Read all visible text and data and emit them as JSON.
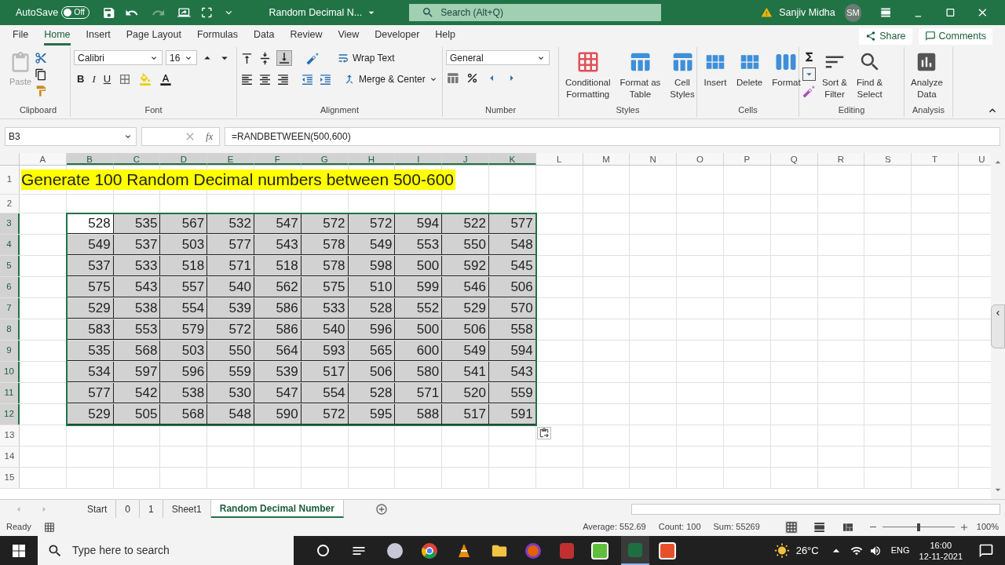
{
  "title_bar": {
    "autosave_label": "AutoSave",
    "autosave_state": "Off",
    "autosave_on": false,
    "file_name": "Random Decimal N...",
    "search_placeholder": "Search (Alt+Q)",
    "user_name": "Sanjiv Midha",
    "user_initials": "SM"
  },
  "ribbon_tabs": [
    {
      "label": "File",
      "selected": false
    },
    {
      "label": "Home",
      "selected": true
    },
    {
      "label": "Insert",
      "selected": false
    },
    {
      "label": "Page Layout",
      "selected": false
    },
    {
      "label": "Formulas",
      "selected": false
    },
    {
      "label": "Data",
      "selected": false
    },
    {
      "label": "Review",
      "selected": false
    },
    {
      "label": "View",
      "selected": false
    },
    {
      "label": "Developer",
      "selected": false
    },
    {
      "label": "Help",
      "selected": false
    }
  ],
  "share": "Share",
  "comments": "Comments",
  "ribbon": {
    "clipboard": {
      "paste": "Paste",
      "label": "Clipboard"
    },
    "font": {
      "font_name": "Calibri",
      "font_size": "16",
      "style_buttons": [
        "B",
        "I",
        "U"
      ],
      "label": "Font"
    },
    "alignment": {
      "wrap_text": "Wrap Text",
      "merge": "Merge & Center",
      "label": "Alignment"
    },
    "number": {
      "format": "General",
      "label": "Number"
    },
    "styles": {
      "buttons": [
        [
          "Conditional",
          "Formatting"
        ],
        [
          "Format as",
          "Table"
        ],
        [
          "Cell",
          "Styles"
        ]
      ],
      "label": "Styles"
    },
    "cells": {
      "buttons": [
        "Insert",
        "Delete",
        "Format"
      ],
      "label": "Cells"
    },
    "editing": {
      "buttons": [
        [
          "Sort &",
          "Filter"
        ],
        [
          "Find &",
          "Select"
        ]
      ],
      "label": "Editing"
    },
    "analysis": {
      "buttons": [
        [
          "Analyze",
          "Data"
        ]
      ],
      "label": "Analysis"
    }
  },
  "formula_bar": {
    "name_box": "B3",
    "fx": "fx",
    "formula": "=RANDBETWEEN(500,600)"
  },
  "columns": [
    {
      "label": "A",
      "selected": false
    },
    {
      "label": "B",
      "selected": true
    },
    {
      "label": "C",
      "selected": true
    },
    {
      "label": "D",
      "selected": true
    },
    {
      "label": "E",
      "selected": true
    },
    {
      "label": "F",
      "selected": true
    },
    {
      "label": "G",
      "selected": true
    },
    {
      "label": "H",
      "selected": true
    },
    {
      "label": "I",
      "selected": true
    },
    {
      "label": "J",
      "selected": true
    },
    {
      "label": "K",
      "selected": true
    },
    {
      "label": "L",
      "selected": false
    },
    {
      "label": "M",
      "selected": false
    },
    {
      "label": "N",
      "selected": false
    },
    {
      "label": "O",
      "selected": false
    },
    {
      "label": "P",
      "selected": false
    },
    {
      "label": "Q",
      "selected": false
    },
    {
      "label": "R",
      "selected": false
    },
    {
      "label": "S",
      "selected": false
    },
    {
      "label": "T",
      "selected": false
    },
    {
      "label": "U",
      "selected": false
    }
  ],
  "rows": [
    {
      "header": "1",
      "selected": false,
      "title": "Generate 100 Random Decimal numbers between 500-600"
    },
    {
      "header": "2",
      "selected": false
    },
    {
      "header": "3",
      "selected": true,
      "cells": [
        {
          "value": "528",
          "active": true
        },
        {
          "value": "535",
          "active": false
        },
        {
          "value": "567",
          "active": false
        },
        {
          "value": "532",
          "active": false
        },
        {
          "value": "547",
          "active": false
        },
        {
          "value": "572",
          "active": false
        },
        {
          "value": "572",
          "active": false
        },
        {
          "value": "594",
          "active": false
        },
        {
          "value": "522",
          "active": false
        },
        {
          "value": "577",
          "active": false
        }
      ]
    },
    {
      "header": "4",
      "selected": true,
      "cells": [
        {
          "value": "549",
          "active": false
        },
        {
          "value": "537",
          "active": false
        },
        {
          "value": "503",
          "active": false
        },
        {
          "value": "577",
          "active": false
        },
        {
          "value": "543",
          "active": false
        },
        {
          "value": "578",
          "active": false
        },
        {
          "value": "549",
          "active": false
        },
        {
          "value": "553",
          "active": false
        },
        {
          "value": "550",
          "active": false
        },
        {
          "value": "548",
          "active": false
        }
      ]
    },
    {
      "header": "5",
      "selected": true,
      "cells": [
        {
          "value": "537",
          "active": false
        },
        {
          "value": "533",
          "active": false
        },
        {
          "value": "518",
          "active": false
        },
        {
          "value": "571",
          "active": false
        },
        {
          "value": "518",
          "active": false
        },
        {
          "value": "578",
          "active": false
        },
        {
          "value": "598",
          "active": false
        },
        {
          "value": "500",
          "active": false
        },
        {
          "value": "592",
          "active": false
        },
        {
          "value": "545",
          "active": false
        }
      ]
    },
    {
      "header": "6",
      "selected": true,
      "cells": [
        {
          "value": "575",
          "active": false
        },
        {
          "value": "543",
          "active": false
        },
        {
          "value": "557",
          "active": false
        },
        {
          "value": "540",
          "active": false
        },
        {
          "value": "562",
          "active": false
        },
        {
          "value": "575",
          "active": false
        },
        {
          "value": "510",
          "active": false
        },
        {
          "value": "599",
          "active": false
        },
        {
          "value": "546",
          "active": false
        },
        {
          "value": "506",
          "active": false
        }
      ]
    },
    {
      "header": "7",
      "selected": true,
      "cells": [
        {
          "value": "529",
          "active": false
        },
        {
          "value": "538",
          "active": false
        },
        {
          "value": "554",
          "active": false
        },
        {
          "value": "539",
          "active": false
        },
        {
          "value": "586",
          "active": false
        },
        {
          "value": "533",
          "active": false
        },
        {
          "value": "528",
          "active": false
        },
        {
          "value": "552",
          "active": false
        },
        {
          "value": "529",
          "active": false
        },
        {
          "value": "570",
          "active": false
        }
      ]
    },
    {
      "header": "8",
      "selected": true,
      "cells": [
        {
          "value": "583",
          "active": false
        },
        {
          "value": "553",
          "active": false
        },
        {
          "value": "579",
          "active": false
        },
        {
          "value": "572",
          "active": false
        },
        {
          "value": "586",
          "active": false
        },
        {
          "value": "540",
          "active": false
        },
        {
          "value": "596",
          "active": false
        },
        {
          "value": "500",
          "active": false
        },
        {
          "value": "506",
          "active": false
        },
        {
          "value": "558",
          "active": false
        }
      ]
    },
    {
      "header": "9",
      "selected": true,
      "cells": [
        {
          "value": "535",
          "active": false
        },
        {
          "value": "568",
          "active": false
        },
        {
          "value": "503",
          "active": false
        },
        {
          "value": "550",
          "active": false
        },
        {
          "value": "564",
          "active": false
        },
        {
          "value": "593",
          "active": false
        },
        {
          "value": "565",
          "active": false
        },
        {
          "value": "600",
          "active": false
        },
        {
          "value": "549",
          "active": false
        },
        {
          "value": "594",
          "active": false
        }
      ]
    },
    {
      "header": "10",
      "selected": true,
      "cells": [
        {
          "value": "534",
          "active": false
        },
        {
          "value": "597",
          "active": false
        },
        {
          "value": "596",
          "active": false
        },
        {
          "value": "559",
          "active": false
        },
        {
          "value": "539",
          "active": false
        },
        {
          "value": "517",
          "active": false
        },
        {
          "value": "506",
          "active": false
        },
        {
          "value": "580",
          "active": false
        },
        {
          "value": "541",
          "active": false
        },
        {
          "value": "543",
          "active": false
        }
      ]
    },
    {
      "header": "11",
      "selected": true,
      "cells": [
        {
          "value": "577",
          "active": false
        },
        {
          "value": "542",
          "active": false
        },
        {
          "value": "538",
          "active": false
        },
        {
          "value": "530",
          "active": false
        },
        {
          "value": "547",
          "active": false
        },
        {
          "value": "554",
          "active": false
        },
        {
          "value": "528",
          "active": false
        },
        {
          "value": "571",
          "active": false
        },
        {
          "value": "520",
          "active": false
        },
        {
          "value": "559",
          "active": false
        }
      ]
    },
    {
      "header": "12",
      "selected": true,
      "cells": [
        {
          "value": "529",
          "active": false
        },
        {
          "value": "505",
          "active": false
        },
        {
          "value": "568",
          "active": false
        },
        {
          "value": "548",
          "active": false
        },
        {
          "value": "590",
          "active": false
        },
        {
          "value": "572",
          "active": false
        },
        {
          "value": "595",
          "active": false
        },
        {
          "value": "588",
          "active": false
        },
        {
          "value": "517",
          "active": false
        },
        {
          "value": "591",
          "active": false
        }
      ]
    },
    {
      "header": "13",
      "selected": false
    },
    {
      "header": "14",
      "selected": false
    },
    {
      "header": "15",
      "selected": false
    }
  ],
  "sheet_tabs": [
    {
      "label": "Start",
      "selected": false
    },
    {
      "label": "0",
      "selected": false
    },
    {
      "label": "1",
      "selected": false
    },
    {
      "label": "Sheet1",
      "selected": false
    },
    {
      "label": "Random Decimal Number",
      "selected": true
    }
  ],
  "status_bar": {
    "ready": "Ready",
    "average": "Average: 552.69",
    "count": "Count: 100",
    "sum": "Sum: 55269",
    "zoom": "100%",
    "level": 0.5
  },
  "taskbar": {
    "search_placeholder": "Type here to search",
    "temperature": "26°C",
    "language": "ENG",
    "time": "16:00",
    "date": "12-11-2021"
  }
}
